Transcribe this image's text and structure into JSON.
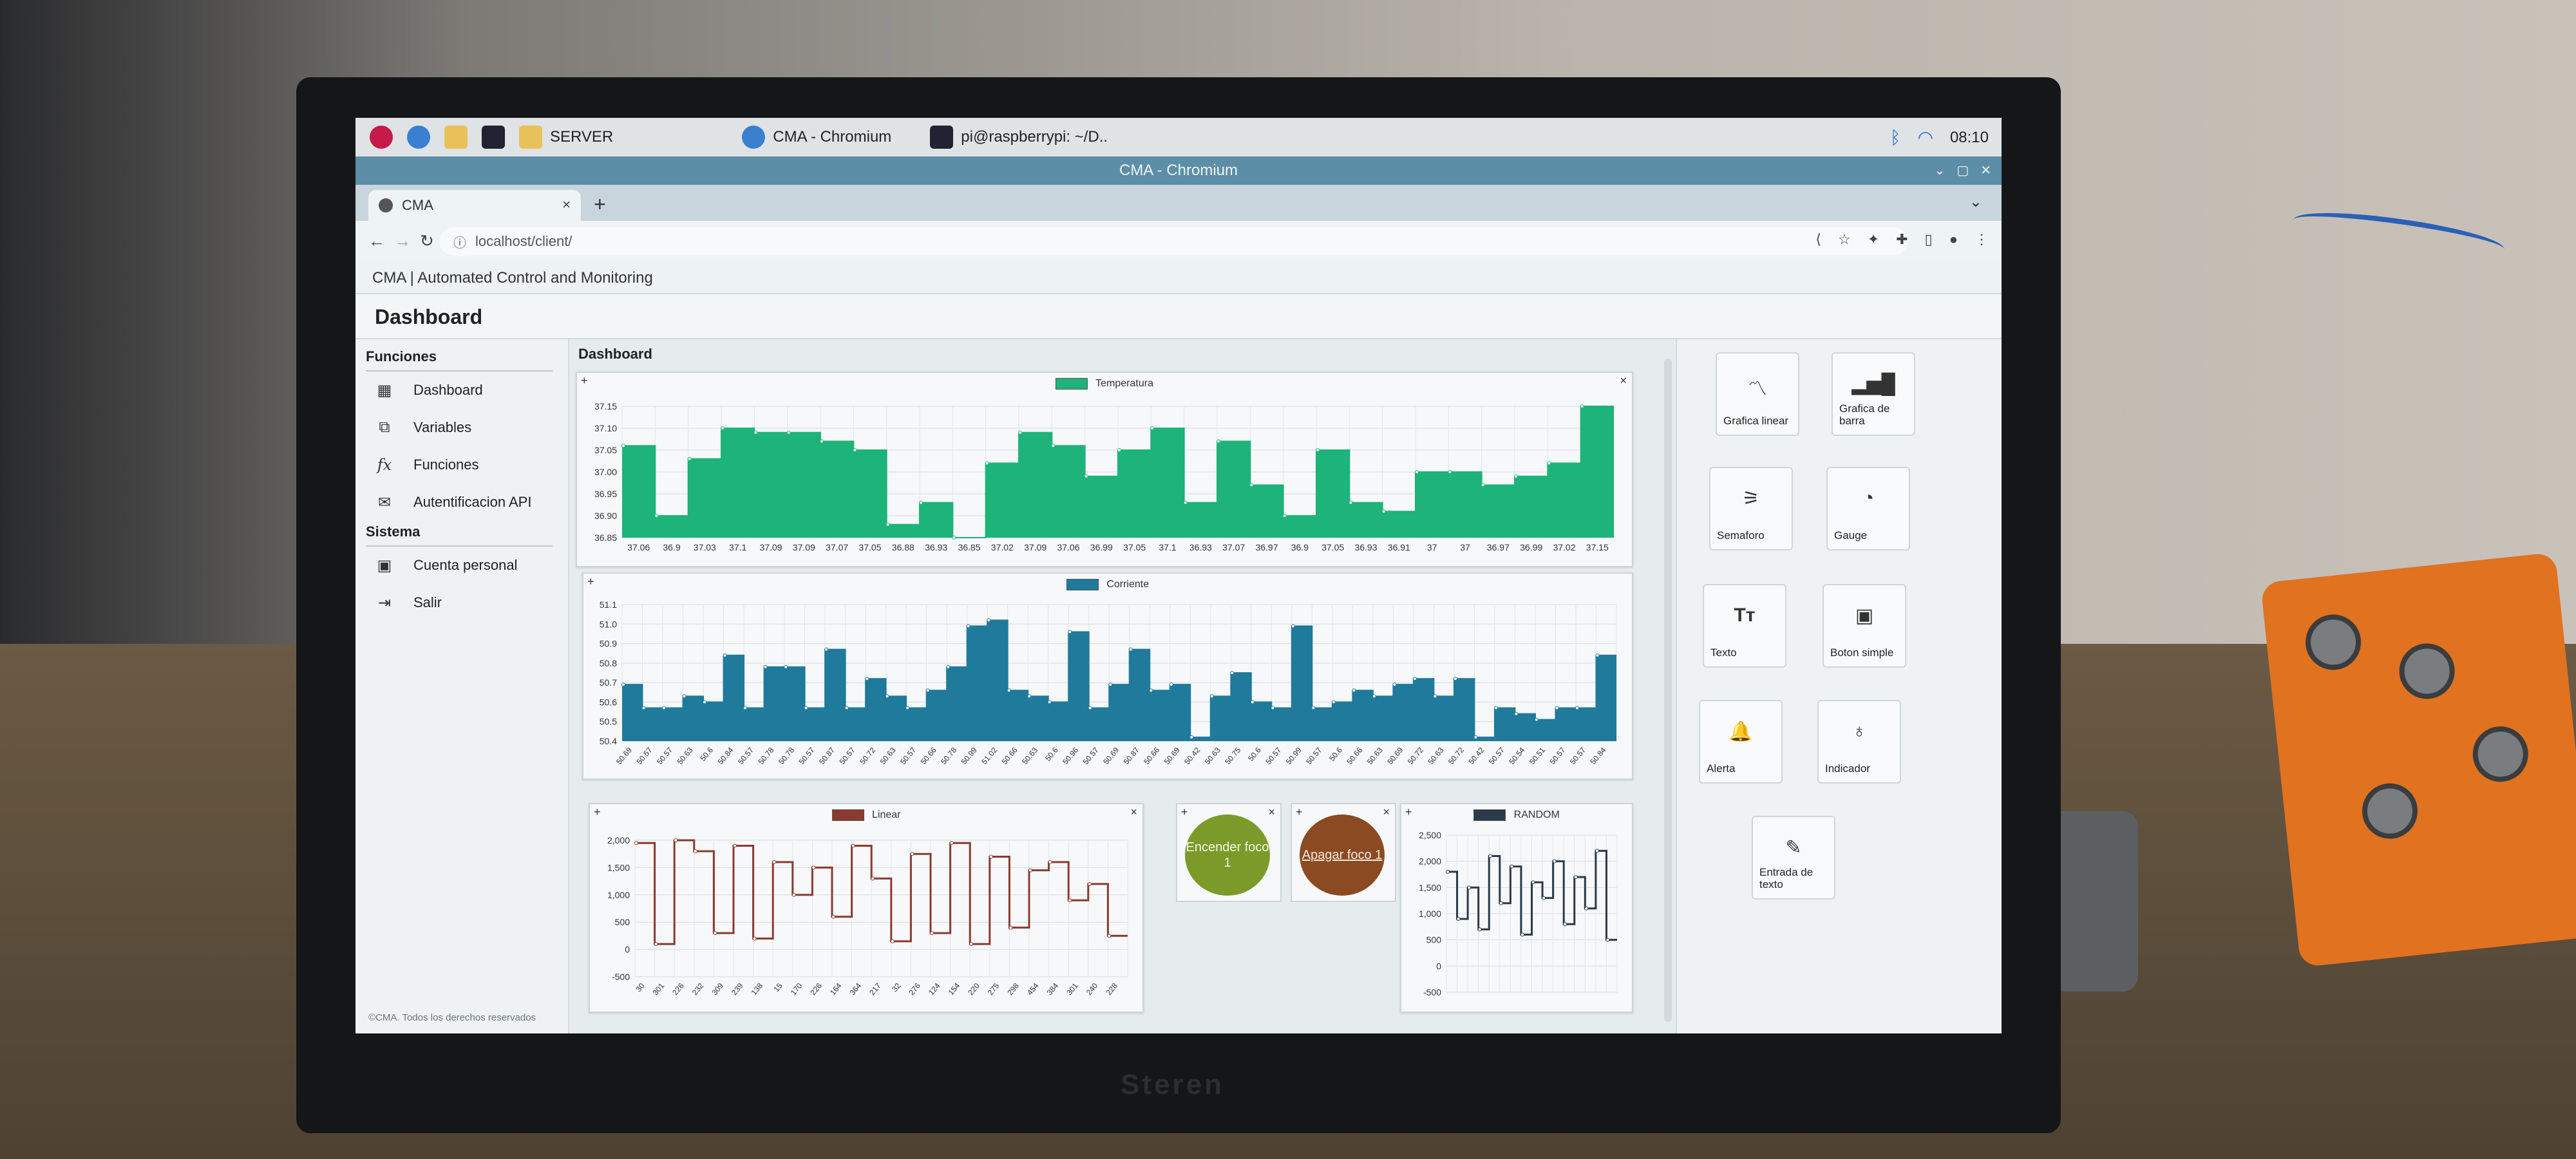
{
  "taskbar": {
    "items": [
      {
        "label": "SERVER"
      },
      {
        "label": "CMA - Chromium"
      },
      {
        "label": "pi@raspberrypi: ~/D.."
      }
    ],
    "time": "08:10"
  },
  "window": {
    "title": "CMA - Chromium"
  },
  "browser": {
    "tab_label": "CMA",
    "tab_close": "×",
    "new_tab": "+",
    "url": "localhost/client/"
  },
  "app": {
    "header": "CMA | Automated Control and Monitoring",
    "page_title": "Dashboard",
    "main_title": "Dashboard",
    "footer": "©CMA. Todos los derechos reservados"
  },
  "sidebar": {
    "section_funciones": "Funciones",
    "section_sistema": "Sistema",
    "funciones": [
      {
        "label": "Dashboard",
        "icon": "dashboard-icon"
      },
      {
        "label": "Variables",
        "icon": "variables-icon"
      },
      {
        "label": "Funciones",
        "icon": "function-icon"
      },
      {
        "label": "Autentificacion API",
        "icon": "mail-icon"
      }
    ],
    "sistema": [
      {
        "label": "Cuenta personal",
        "icon": "account-icon"
      },
      {
        "label": "Salir",
        "icon": "logout-icon"
      }
    ]
  },
  "widgets": {
    "temperatura": {
      "legend": "Temperatura",
      "color": "#1db37a"
    },
    "corriente": {
      "legend": "Corriente",
      "color": "#1f7a9c"
    },
    "linear": {
      "legend": "Linear",
      "color": "#8a3a30"
    },
    "random": {
      "legend": "RANDOM",
      "color": "#2a3a4a"
    },
    "encender": {
      "label": "Encender foco 1",
      "color": "#7c9a2a"
    },
    "apagar": {
      "label": "Apagar foco 1",
      "color": "#8b4a22"
    }
  },
  "tools": [
    {
      "label": "Grafica linear",
      "icon": "line-chart-icon"
    },
    {
      "label": "Grafica de barra",
      "icon": "bar-chart-icon"
    },
    {
      "label": "Semaforo",
      "icon": "traffic-light-icon"
    },
    {
      "label": "Gauge",
      "icon": "gauge-icon"
    },
    {
      "label": "Texto",
      "icon": "text-icon"
    },
    {
      "label": "Boton simple",
      "icon": "button-icon"
    },
    {
      "label": "Alerta",
      "icon": "alert-icon"
    },
    {
      "label": "Indicador",
      "icon": "bulb-icon"
    },
    {
      "label": "Entrada de texto",
      "icon": "pencil-icon"
    }
  ],
  "chart_data": [
    {
      "type": "area",
      "legend": "Temperatura",
      "ylim": [
        36.85,
        37.15
      ],
      "y_ticks": [
        "37.15",
        "37.10",
        "37.05",
        "37.00",
        "36.95",
        "36.90",
        "36.85"
      ],
      "categories": [
        "37.06",
        "36.9",
        "37.03",
        "37.1",
        "37.09",
        "37.09",
        "37.07",
        "37.05",
        "36.88",
        "36.93",
        "36.85",
        "37.02",
        "37.09",
        "37.06",
        "36.99",
        "37.05",
        "37.1",
        "36.93",
        "37.07",
        "36.97",
        "36.9",
        "37.05",
        "36.93",
        "36.91",
        "37",
        "37",
        "36.97",
        "36.99",
        "37.02",
        "37.15"
      ],
      "values": [
        37.06,
        36.9,
        37.03,
        37.1,
        37.09,
        37.09,
        37.07,
        37.05,
        36.88,
        36.93,
        36.85,
        37.02,
        37.09,
        37.06,
        36.99,
        37.05,
        37.1,
        36.93,
        37.07,
        36.97,
        36.9,
        37.05,
        36.93,
        36.91,
        37.0,
        37.0,
        36.97,
        36.99,
        37.02,
        37.15
      ]
    },
    {
      "type": "area",
      "legend": "Corriente",
      "ylim": [
        50.4,
        51.1
      ],
      "y_ticks": [
        "51.1",
        "51.0",
        "50.9",
        "50.8",
        "50.7",
        "50.6",
        "50.5",
        "50.4"
      ],
      "categories": [
        "50.69",
        "50.57",
        "50.57",
        "50.63",
        "50.6",
        "50.84",
        "50.57",
        "50.78",
        "50.78",
        "50.57",
        "50.87",
        "50.57",
        "50.72",
        "50.63",
        "50.57",
        "50.66",
        "50.78",
        "50.99",
        "51.02",
        "50.66",
        "50.63",
        "50.6",
        "50.96",
        "50.57",
        "50.69",
        "50.87",
        "50.66",
        "50.69",
        "50.42",
        "50.63",
        "50.75",
        "50.6",
        "50.57",
        "50.99",
        "50.57",
        "50.6",
        "50.66",
        "50.63",
        "50.69",
        "50.72",
        "50.63",
        "50.72",
        "50.42",
        "50.57",
        "50.54",
        "50.51",
        "50.57",
        "50.57",
        "50.84"
      ],
      "values": [
        50.69,
        50.57,
        50.57,
        50.63,
        50.6,
        50.84,
        50.57,
        50.78,
        50.78,
        50.57,
        50.87,
        50.57,
        50.72,
        50.63,
        50.57,
        50.66,
        50.78,
        50.99,
        51.02,
        50.66,
        50.63,
        50.6,
        50.96,
        50.57,
        50.69,
        50.87,
        50.66,
        50.69,
        50.42,
        50.63,
        50.75,
        50.6,
        50.57,
        50.99,
        50.57,
        50.6,
        50.66,
        50.63,
        50.69,
        50.72,
        50.63,
        50.72,
        50.42,
        50.57,
        50.54,
        50.51,
        50.57,
        50.57,
        50.84
      ]
    },
    {
      "type": "line",
      "legend": "Linear",
      "ylim": [
        -500,
        2000
      ],
      "y_ticks": [
        "2,000",
        "1,500",
        "1,000",
        "500",
        "0",
        "-500"
      ],
      "categories": [
        "30",
        "301",
        "226",
        "232",
        "309",
        "239",
        "138",
        "15",
        "170",
        "226",
        "164",
        "364",
        "217",
        "32",
        "276",
        "124",
        "154",
        "220",
        "275",
        "298",
        "454",
        "384",
        "301",
        "240",
        "228"
      ],
      "values": [
        1950,
        100,
        2000,
        1800,
        300,
        1900,
        200,
        1600,
        1000,
        1500,
        600,
        1900,
        1300,
        150,
        1750,
        300,
        1950,
        100,
        1700,
        400,
        1450,
        1600,
        900,
        1200,
        250
      ]
    },
    {
      "type": "line",
      "legend": "RANDOM",
      "ylim": [
        -500,
        2500
      ],
      "y_ticks": [
        "2,500",
        "2,000",
        "1,500",
        "1,000",
        "500",
        "0",
        "-500"
      ],
      "categories": [],
      "values": [
        1800,
        900,
        1500,
        700,
        2100,
        1200,
        1900,
        600,
        1600,
        1300,
        2000,
        800,
        1700,
        1100,
        2200,
        500
      ]
    }
  ]
}
